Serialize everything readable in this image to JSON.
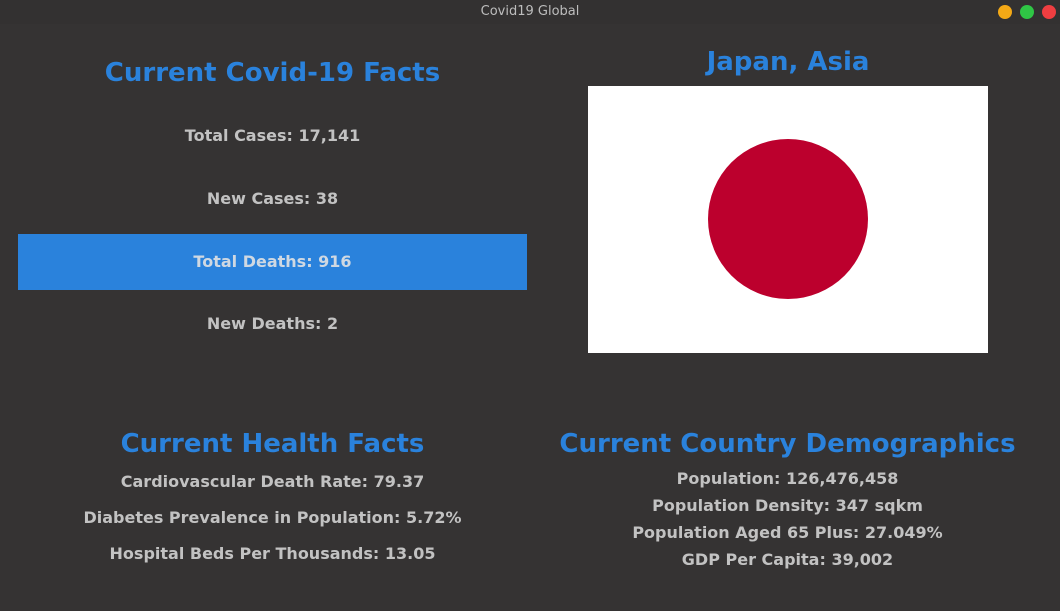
{
  "window": {
    "title": "Covid19 Global"
  },
  "facts": {
    "heading": "Current Covid-19 Facts",
    "total_cases": "Total Cases: 17,141",
    "new_cases": "New Cases: 38",
    "total_deaths": "Total Deaths: 916",
    "new_deaths": "New Deaths: 2"
  },
  "country": {
    "heading": "Japan, Asia",
    "flag_icon": "japan-flag",
    "flag_colors": {
      "field": "#ffffff",
      "disc": "#bc002d"
    }
  },
  "health": {
    "heading": "Current Health Facts",
    "cardio": "Cardiovascular Death Rate: 79.37",
    "diabetes": "Diabetes Prevalence in Population: 5.72%",
    "beds": "Hospital Beds Per Thousands: 13.05"
  },
  "demographics": {
    "heading": "Current Country Demographics",
    "population": "Population: 126,476,458",
    "density": "Population Density: 347 sqkm",
    "aged65": "Population Aged 65 Plus: 27.049%",
    "gdp": "GDP Per Capita: 39,002"
  },
  "colors": {
    "accent": "#2a82dc",
    "background": "#353333",
    "text": "#c2c2c2"
  }
}
